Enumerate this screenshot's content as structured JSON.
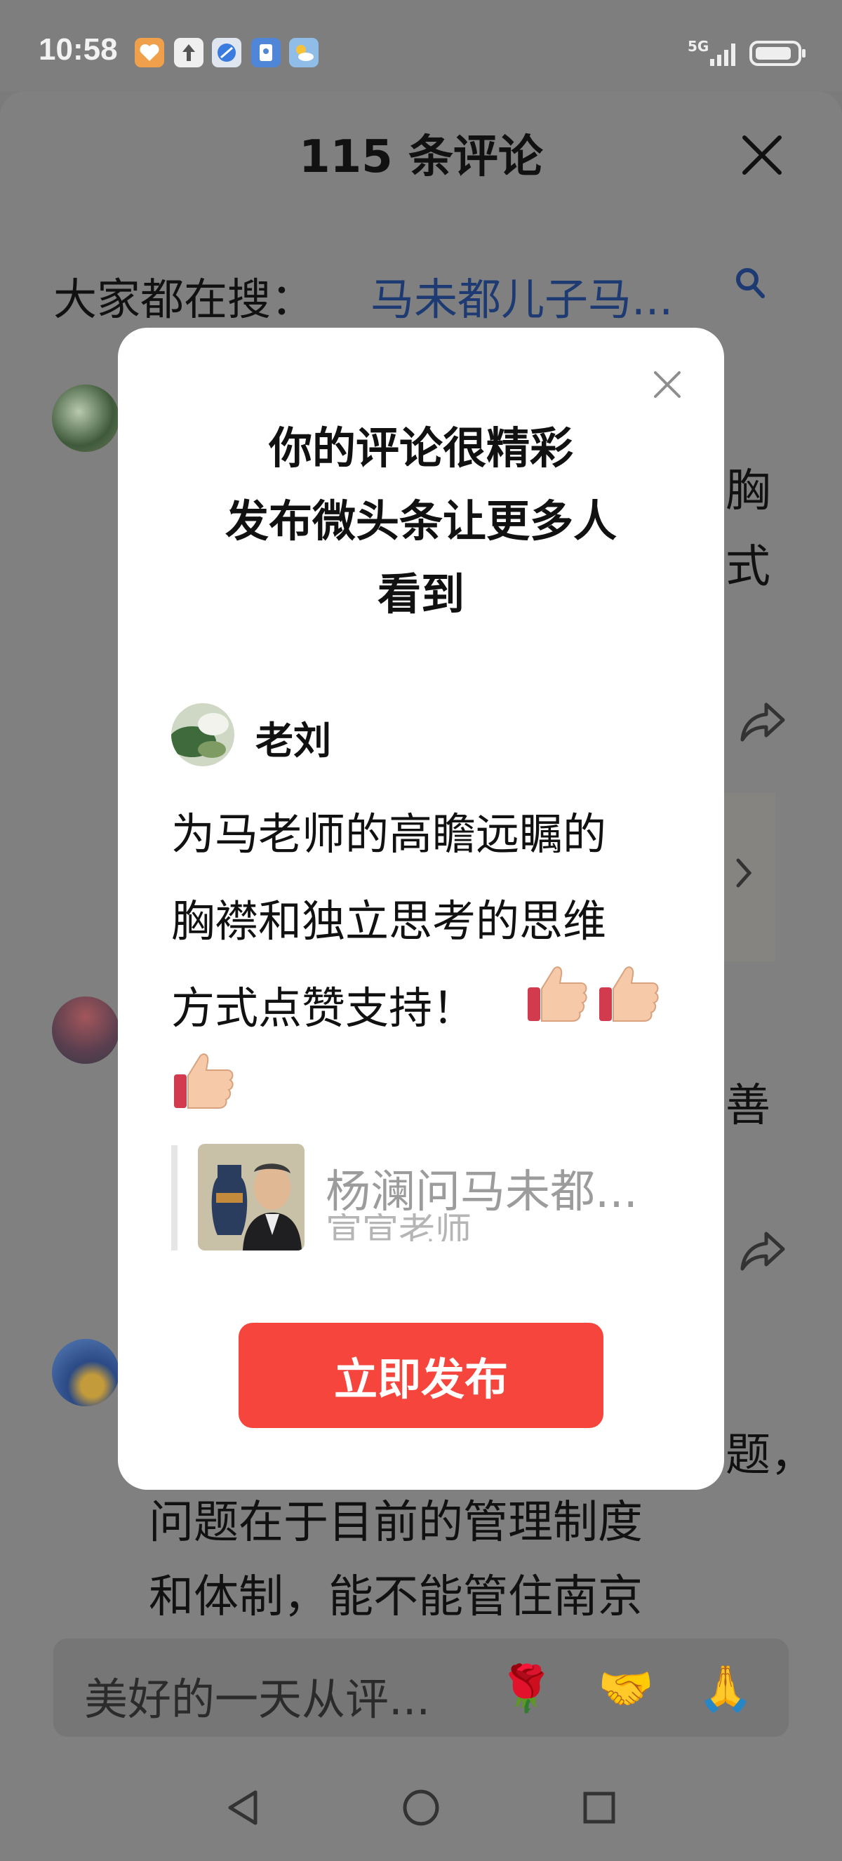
{
  "status_bar": {
    "time": "10:58",
    "network": "5G",
    "app_icons": [
      "heart-app-icon",
      "upload-icon",
      "browser-icon",
      "safety-icon",
      "weather-icon"
    ]
  },
  "sheet": {
    "title": "115 条评论",
    "trending_label": "大家都在搜：",
    "trending_query": "马未都儿子马..."
  },
  "background_comments": [
    {
      "text_lines": [
        "胸",
        "式"
      ]
    },
    {
      "text_lines": [
        "善"
      ]
    },
    {
      "text_lines": [
        "题，",
        "问题在于目前的管理制度",
        "和体制，能不能管住南京"
      ]
    }
  ],
  "popup": {
    "title_lines": [
      "你的评论很精彩",
      "发布微头条让更多人",
      "看到"
    ],
    "author": "老刘",
    "comment_lines": [
      "为马老师的高瞻远瞩的",
      "胸襟和独立思考的思维",
      "方式点赞支持！"
    ],
    "quote_title": "杨澜问马未都...",
    "quote_subtitle": "宣宣老师",
    "publish_label": "立即发布"
  },
  "comment_input": {
    "placeholder": "美好的一天从评...",
    "quick_emojis": [
      "🌹",
      "🤝",
      "🙏"
    ]
  },
  "colors": {
    "accent": "#f5453d",
    "link": "#1d3a72",
    "overlay": "#808080"
  }
}
